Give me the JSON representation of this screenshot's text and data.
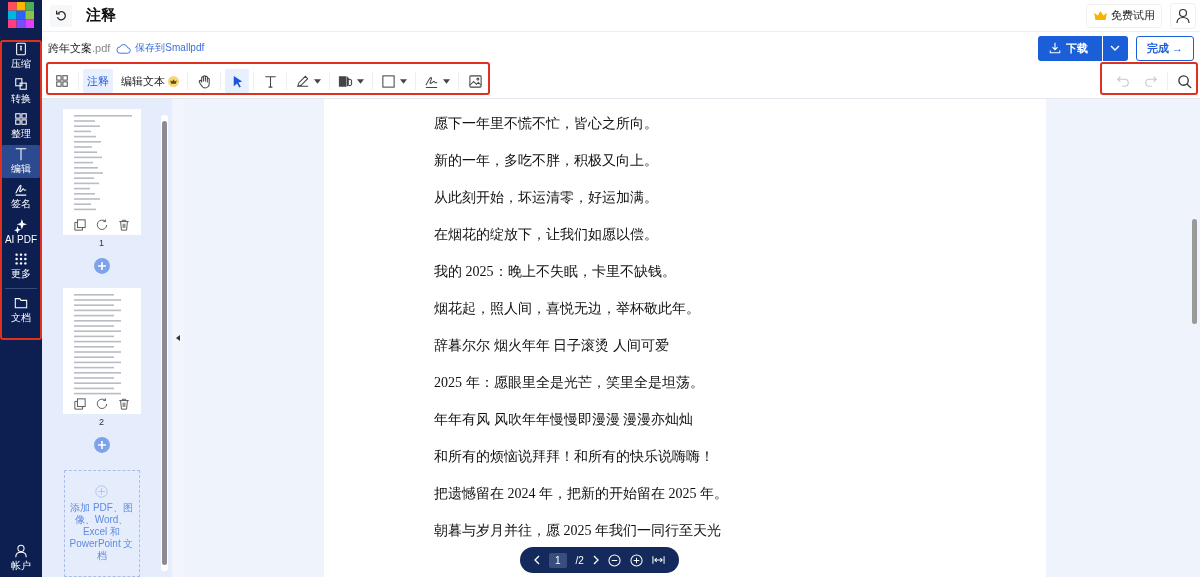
{
  "header": {
    "title": "注释",
    "trial_button": "免费试用"
  },
  "sidebar": {
    "items": [
      {
        "kind": "compress",
        "label": "压缩",
        "selected": false
      },
      {
        "kind": "convert",
        "label": "转换",
        "selected": false
      },
      {
        "kind": "organize",
        "label": "整理",
        "selected": false
      },
      {
        "kind": "edit",
        "label": "编辑",
        "selected": true
      },
      {
        "kind": "sign",
        "label": "签名",
        "selected": false
      },
      {
        "kind": "ai",
        "label": "AI PDF",
        "selected": false
      },
      {
        "kind": "more",
        "label": "更多",
        "selected": false
      },
      {
        "kind": "documents",
        "label": "文档",
        "selected": false
      }
    ],
    "account": "帐户"
  },
  "file": {
    "name": "跨年文案",
    "extension": ".pdf",
    "save_link": "保存到Smallpdf"
  },
  "actions": {
    "download": "下载",
    "finish": "完成 →"
  },
  "toolbar": {
    "modes": [
      {
        "label": "注释",
        "selected": true,
        "premium": false
      },
      {
        "label": "编辑文本",
        "selected": false,
        "premium": true
      }
    ],
    "tools": [
      {
        "kind": "hand",
        "selected": false,
        "dropdown": false
      },
      {
        "kind": "pointer",
        "selected": true,
        "dropdown": false
      },
      {
        "kind": "text",
        "selected": false,
        "dropdown": false
      },
      {
        "kind": "pen",
        "selected": false,
        "dropdown": true
      },
      {
        "kind": "highlight-text",
        "selected": false,
        "dropdown": true
      },
      {
        "kind": "shape",
        "selected": false,
        "dropdown": true
      },
      {
        "kind": "signature",
        "selected": false,
        "dropdown": true
      },
      {
        "kind": "image",
        "selected": false,
        "dropdown": false
      }
    ],
    "undo": {
      "disabled": true
    },
    "redo": {
      "disabled": true
    }
  },
  "thumbnails": {
    "pages": [
      {
        "number": "1"
      },
      {
        "number": "2"
      }
    ],
    "add_card": "添加 PDF、图像、Word、Excel 和 PowerPoint 文档"
  },
  "document": {
    "lines": [
      "愿下一年里不慌不忙，皆心之所向。",
      "新的一年，多吃不胖，积极又向上。",
      "从此刻开始，坏运清零，好运加满。",
      "在烟花的绽放下，让我们如愿以偿。",
      "我的 2025：晚上不失眠，卡里不缺钱。",
      "烟花起，照人间，喜悦无边，举杯敬此年。",
      "辞暮尔尔  烟火年年  日子滚烫  人间可爱",
      "2025 年：愿眼里全是光芒，笑里全是坦荡。",
      "年年有风  风吹年年慢慢即漫漫  漫漫亦灿灿",
      "和所有的烦恼说拜拜！和所有的快乐说嗨嗨！",
      "把遗憾留在 2024 年，把新的开始留在 2025 年。",
      "朝暮与岁月并往，愿 2025 年我们一同行至天光"
    ]
  },
  "pager": {
    "page": "1",
    "total": "/2"
  }
}
